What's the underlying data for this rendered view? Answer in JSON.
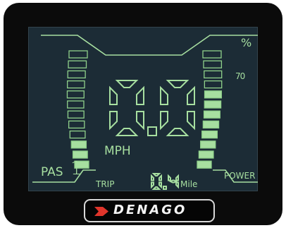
{
  "display": {
    "percent_symbol": "%",
    "scale_mark": "70",
    "speed_value": "0.0",
    "speed_unit": "MPH",
    "pas_label": "PAS",
    "pas_level": "1",
    "trip_label": "TRIP",
    "trip_value": "0.4",
    "trip_unit": "Mile",
    "power_label": "POWER"
  },
  "gauges": {
    "assist_segments_total": 12,
    "assist_segments_lit": 3,
    "power_segments_total": 12,
    "power_segments_lit": 8
  },
  "brand": {
    "name": "DENAGO"
  },
  "colors": {
    "lcd_bg": "#1c2c36",
    "segment_lit": "#a7dfa0",
    "segment_outline": "#8fd08a",
    "bezel": "#0b0b0b",
    "brand_accent": "#e0352b"
  }
}
